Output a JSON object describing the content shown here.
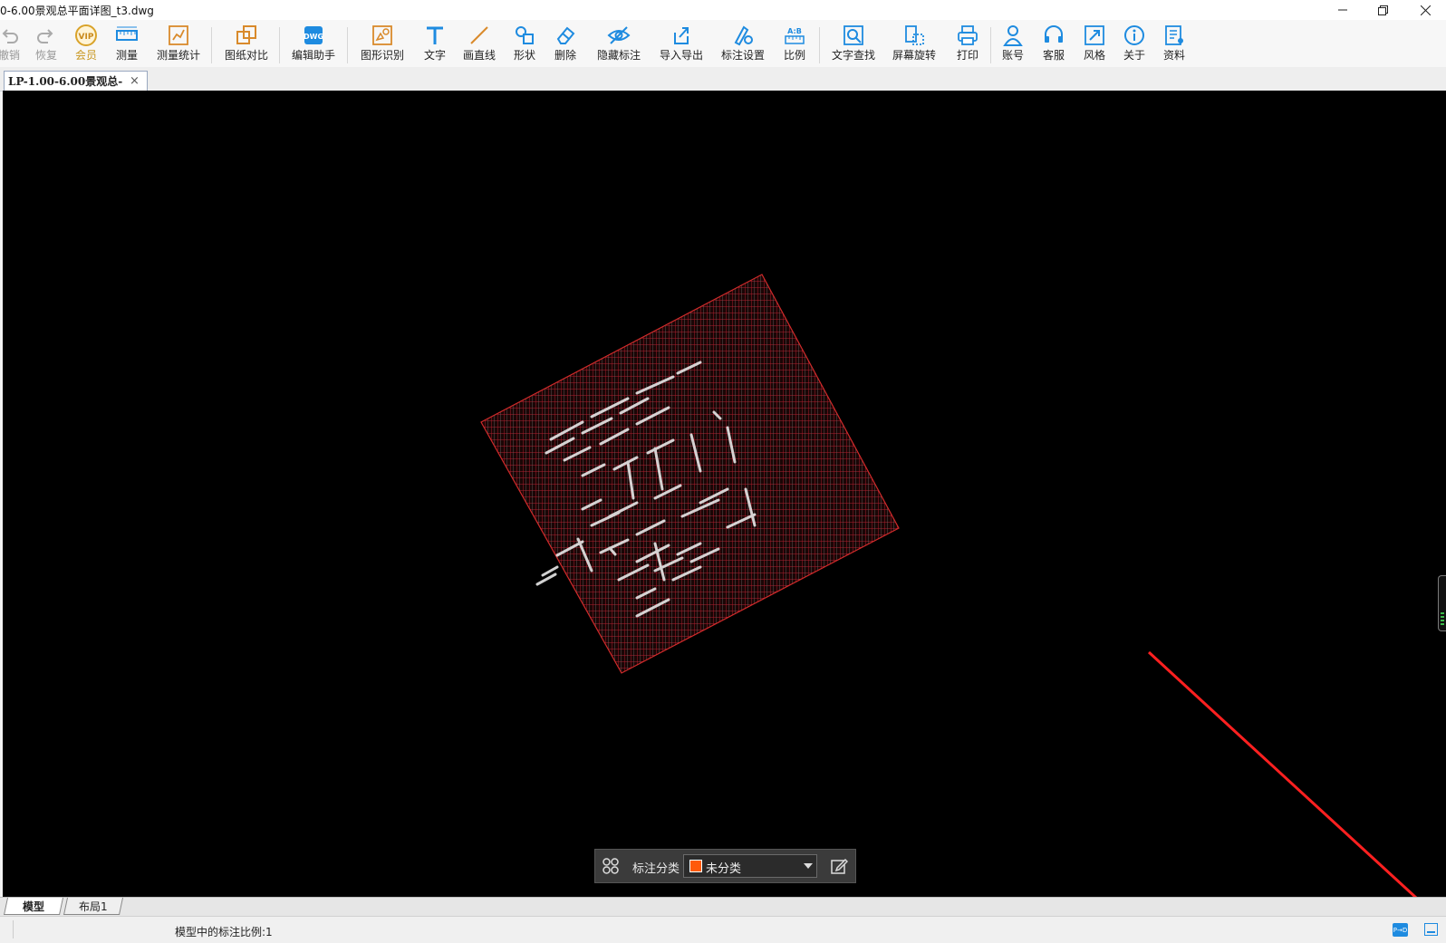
{
  "window": {
    "title": "0-6.00景观总平面详图_t3.dwg",
    "controls": [
      "minimize",
      "restore",
      "close"
    ]
  },
  "toolbar": {
    "items": [
      {
        "label": "撤销",
        "icon": "undo-icon",
        "disabled": true
      },
      {
        "label": "恢复",
        "icon": "redo-icon",
        "disabled": true
      },
      {
        "label": "会员",
        "icon": "vip-icon"
      },
      {
        "label": "测量",
        "icon": "ruler-icon"
      },
      {
        "label": "测量统计",
        "icon": "measure-stats-icon"
      },
      {
        "label": "图纸对比",
        "icon": "compare-icon"
      },
      {
        "label": "编辑助手",
        "icon": "edit-assistant-icon"
      },
      {
        "label": "图形识别",
        "icon": "shape-recognition-icon"
      },
      {
        "label": "文字",
        "icon": "text-icon"
      },
      {
        "label": "画直线",
        "icon": "line-icon"
      },
      {
        "label": "形状",
        "icon": "shape-icon"
      },
      {
        "label": "删除",
        "icon": "eraser-icon"
      },
      {
        "label": "隐藏标注",
        "icon": "hide-annotation-icon"
      },
      {
        "label": "导入导出",
        "icon": "import-export-icon"
      },
      {
        "label": "标注设置",
        "icon": "annotation-settings-icon"
      },
      {
        "label": "比例",
        "icon": "scale-icon"
      },
      {
        "label": "文字查找",
        "icon": "text-search-icon"
      },
      {
        "label": "屏幕旋转",
        "icon": "rotate-screen-icon"
      },
      {
        "label": "打印",
        "icon": "print-icon"
      },
      {
        "label": "账号",
        "icon": "account-icon"
      },
      {
        "label": "客服",
        "icon": "headset-icon"
      },
      {
        "label": "风格",
        "icon": "style-icon"
      },
      {
        "label": "关于",
        "icon": "info-icon"
      },
      {
        "label": "资料",
        "icon": "resources-icon"
      }
    ]
  },
  "doc_tab": {
    "label": "LP-1.00-6.00景观总-",
    "close": "×"
  },
  "annotation_bar": {
    "label": "标注分类",
    "selected": "未分类",
    "swatch_color": "#ff5a0a"
  },
  "layout_tabs": [
    "模型",
    "布局1"
  ],
  "status": {
    "scale_text": "模型中的标注比例:1"
  },
  "colors": {
    "canvas_bg": "#000000",
    "accent_blue": "#1e8be0",
    "drawing_red": "#c8252d",
    "arrow_red": "#ff2020"
  }
}
